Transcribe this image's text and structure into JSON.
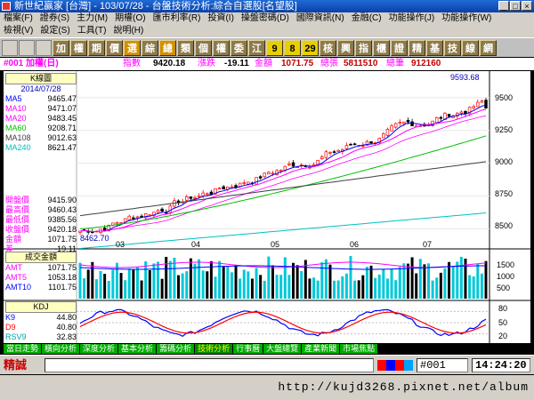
{
  "window": {
    "title": "新世紀贏家 [台灣] - 103/07/28 - 台盤技術分析:綜合自選股[名望股]",
    "buttons": [
      "_",
      "□",
      "×"
    ]
  },
  "menu1": [
    "檔案(F)",
    "證券(S)",
    "主力(M)",
    "期權(O)",
    "匯市利率(R)",
    "投資(I)",
    "操盤密碼(D)",
    "國際資訊(N)",
    "金融(C)",
    "功能操作(J)",
    "功能操作(W)"
  ],
  "menu2": [
    "檢視(V)",
    "設定(S)",
    "工具(T)",
    "說明(H)"
  ],
  "toolbar": {
    "buttons": [
      "加",
      "權",
      "期",
      "價",
      "選",
      "綜",
      "總",
      "類",
      "個",
      "權",
      "委",
      "江",
      "9",
      "8",
      "29",
      "核",
      "興",
      "指",
      "櫃",
      "證",
      "精",
      "基",
      "技",
      "線",
      "網"
    ]
  },
  "info": {
    "code": "#001 加權(日)",
    "index_label": "指數",
    "index_value": "9420.18",
    "change_label": "漲跌",
    "change_value": "-19.11",
    "amount_label": "金額",
    "amount_value": "1071.75",
    "volume_label": "總張",
    "volume_value": "5811510",
    "count_label": "總筆",
    "count_value": "912160"
  },
  "price_panel": {
    "header": "K線圖",
    "date": "2014/07/28",
    "ma": [
      {
        "label": "MA5",
        "value": "9465.47",
        "color": "#0000ff"
      },
      {
        "label": "MA10",
        "value": "9471.07",
        "color": "#ff00ff"
      },
      {
        "label": "MA20",
        "value": "9483.45",
        "color": "#ff00ff"
      },
      {
        "label": "MA60",
        "value": "9208.71",
        "color": "#00c000"
      },
      {
        "label": "MA108",
        "value": "9012.63",
        "color": "#404040"
      },
      {
        "label": "MA240",
        "value": "8621.47",
        "color": "#00c0c0"
      }
    ],
    "ohlc": [
      {
        "label": "開盤價",
        "value": "9415.90"
      },
      {
        "label": "最高價",
        "value": "9460.43"
      },
      {
        "label": "最低價",
        "value": "9385.56"
      },
      {
        "label": "收盤價",
        "value": "9420.18"
      },
      {
        "label": "金額",
        "value": "1071.75"
      },
      {
        "label": "差",
        "value": "-19.11"
      }
    ],
    "high_marker": "9593.68",
    "low_marker": "8462.70",
    "y_ticks": [
      "9500",
      "9250",
      "9000",
      "8750",
      "8500"
    ],
    "x_ticks": [
      "03",
      "04",
      "05",
      "06",
      "07"
    ]
  },
  "volume_panel": {
    "header": "成交金額",
    "rows": [
      {
        "label": "AMT",
        "value": "1071.75"
      },
      {
        "label": "AMT5",
        "value": "1053.18"
      },
      {
        "label": "AMT10",
        "value": "1101.75"
      }
    ],
    "y_ticks": [
      "1500",
      "1000",
      "500"
    ]
  },
  "kd_panel": {
    "header": "KDJ",
    "rows": [
      {
        "label": "K9",
        "value": "44.80"
      },
      {
        "label": "D9",
        "value": "40.80"
      },
      {
        "label": "RSV9",
        "value": "32.83"
      }
    ],
    "y_ticks": [
      "80",
      "50",
      "20"
    ]
  },
  "tabs": [
    "當日走勢",
    "橫向分析",
    "深度分析",
    "基本分析",
    "籌碼分析",
    "技術分析",
    "行事曆",
    "大盤總覽",
    "產業新聞",
    "市場焦點"
  ],
  "active_tab": "技術分析",
  "status": {
    "label": "精誠",
    "code": "#001",
    "time": "14:24:20"
  },
  "watermark": "http://kujd3268.pixnet.net/album",
  "colors": {
    "up": "#ff0000",
    "down": "#000000",
    "panel_bg": "#ffffff",
    "label_text": "#ff00ff"
  }
}
